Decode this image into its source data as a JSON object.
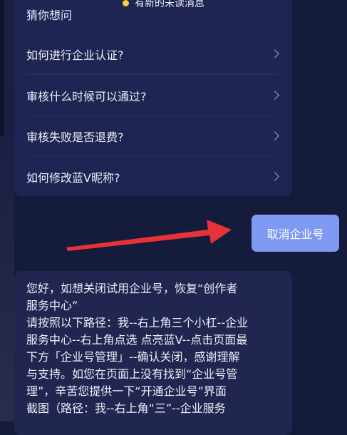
{
  "toast": {
    "text": "有新的未读消息",
    "dot_color": "#ffcf33"
  },
  "faq": {
    "heading": "猜你想问",
    "items": [
      {
        "label": "如何进行企业认证?"
      },
      {
        "label": "审核什么时候可以通过?"
      },
      {
        "label": "审核失败是否退费?"
      },
      {
        "label": "如何修改蓝V昵称?"
      }
    ]
  },
  "cancel_button": {
    "label": "取消企业号",
    "color": "#7f9af3"
  },
  "annotation": {
    "arrow_color": "#e8323a"
  },
  "reply": {
    "lines": [
      "您好，如想关闭试用企业号，恢复“创作者",
      "服务中心”",
      "请按照以下路径：我--右上角三个小杠--企业",
      "服务中心--右上角点选 点亮蓝V--点击页面最",
      "下方「企业号管理」--确认关闭，感谢理解",
      "与支持。如您在页面上没有找到“企业号管",
      "理”，辛苦您提供一下“开通企业号”界面",
      "截图（路径：我--右上角“三”--企业服务"
    ]
  }
}
